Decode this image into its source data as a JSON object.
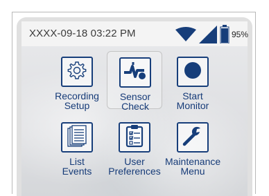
{
  "status": {
    "datetime": "XXXX-09-18 03:22 PM",
    "wifi_icon": "wifi-icon",
    "signal_icon": "cell-signal-icon",
    "battery_icon": "battery-icon",
    "battery_level": 0.95,
    "battery_text": "95%"
  },
  "colors": {
    "accent": "#173e7a",
    "label": "#163b78"
  },
  "menu": [
    {
      "line1": "Recording",
      "line2": "Setup",
      "icon": "gear-icon",
      "selected": false
    },
    {
      "line1": "Sensor",
      "line2": "Check",
      "icon": "sensor-check-icon",
      "selected": true
    },
    {
      "line1": "Start",
      "line2": "Monitor",
      "icon": "record-icon",
      "selected": false
    },
    {
      "line1": "List",
      "line2": "Events",
      "icon": "document-list-icon",
      "selected": false
    },
    {
      "line1": "User",
      "line2": "Preferences",
      "icon": "clipboard-checklist-icon",
      "selected": false
    },
    {
      "line1": "Maintenance",
      "line2": "Menu",
      "icon": "wrench-icon",
      "selected": false
    }
  ]
}
